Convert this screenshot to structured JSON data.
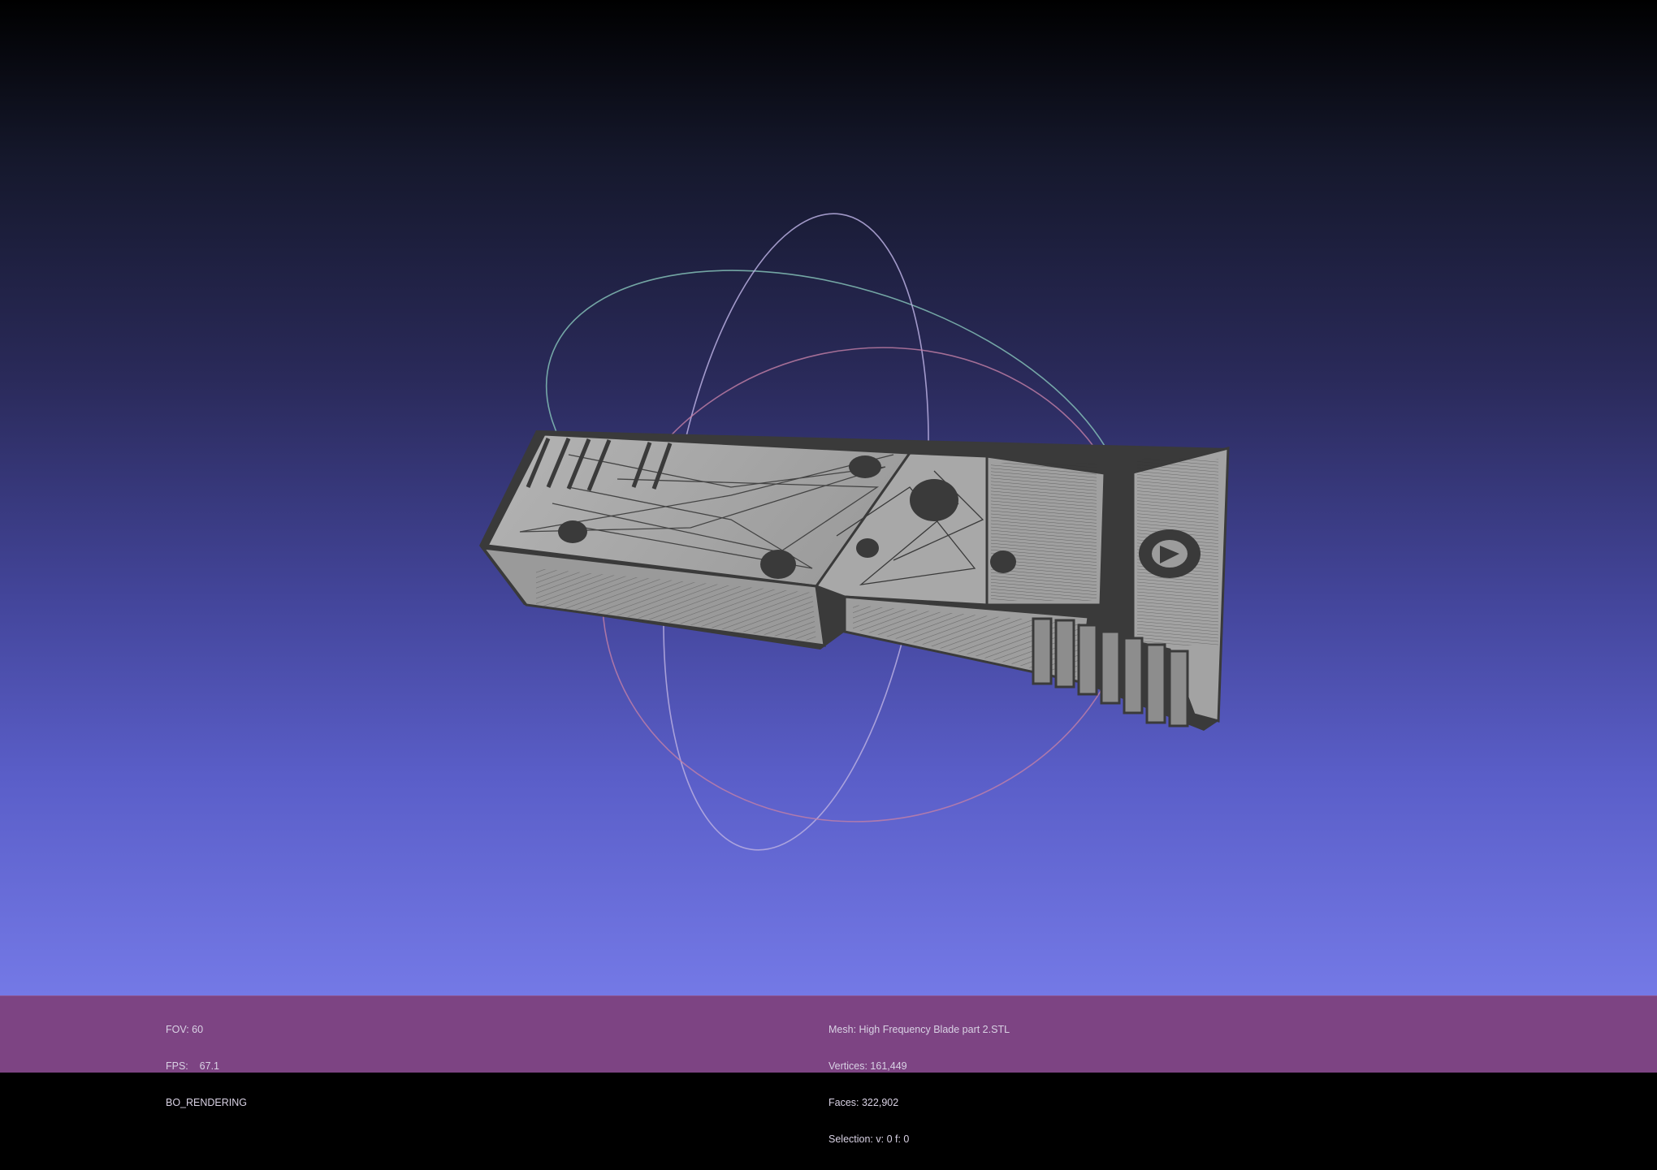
{
  "viewport": {
    "background_top": "#000000",
    "background_bottom": "#7479e6",
    "mesh_color": "#a9a9a9",
    "wire_color": "#3c3c3c",
    "trackball_colors": [
      "#7fc4b7",
      "#b0a6d8",
      "#c77fa6"
    ]
  },
  "info_bar": {
    "background": "#7d4483",
    "left": {
      "fov": "FOV: 60",
      "fps": "FPS:    67.1",
      "render_mode": "BO_RENDERING"
    },
    "right": {
      "mesh": "Mesh: High Frequency Blade part 2.STL",
      "vertices": "Vertices: 161,449",
      "faces": "Faces: 322,902",
      "selection": "Selection: v: 0 f: 0"
    }
  }
}
